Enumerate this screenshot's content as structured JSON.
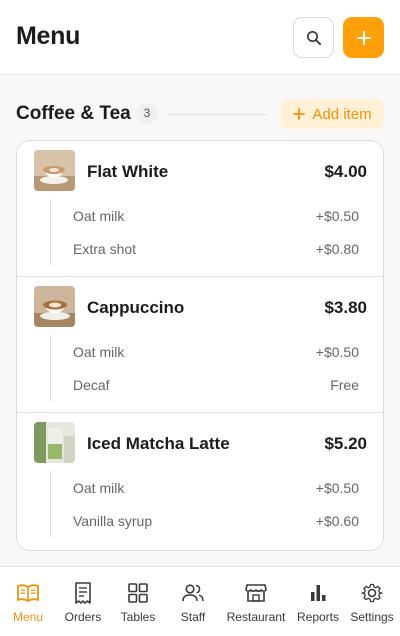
{
  "header": {
    "title": "Menu"
  },
  "section": {
    "title": "Coffee & Tea",
    "count": "3",
    "add_label": "Add item"
  },
  "items": [
    {
      "name": "Flat White",
      "price": "$4.00",
      "modifiers": [
        {
          "label": "Oat milk",
          "price": "+$0.50"
        },
        {
          "label": "Extra shot",
          "price": "+$0.80"
        }
      ]
    },
    {
      "name": "Cappuccino",
      "price": "$3.80",
      "modifiers": [
        {
          "label": "Oat milk",
          "price": "+$0.50"
        },
        {
          "label": "Decaf",
          "price": "Free"
        }
      ]
    },
    {
      "name": "Iced Matcha Latte",
      "price": "$5.20",
      "modifiers": [
        {
          "label": "Oat milk",
          "price": "+$0.50"
        },
        {
          "label": "Vanilla syrup",
          "price": "+$0.60"
        }
      ]
    }
  ],
  "tabs": [
    {
      "label": "Menu",
      "icon": "book-open-icon",
      "active": true
    },
    {
      "label": "Orders",
      "icon": "receipt-icon"
    },
    {
      "label": "Tables",
      "icon": "grid-icon"
    },
    {
      "label": "Staff",
      "icon": "users-icon"
    },
    {
      "label": "Restaurant",
      "icon": "storefront-icon"
    },
    {
      "label": "Reports",
      "icon": "bar-chart-icon"
    },
    {
      "label": "Settings",
      "icon": "gear-icon"
    }
  ],
  "colors": {
    "accent": "#ff9f0a",
    "accent_text": "#f5900a",
    "accent_soft": "#fff0d6"
  }
}
